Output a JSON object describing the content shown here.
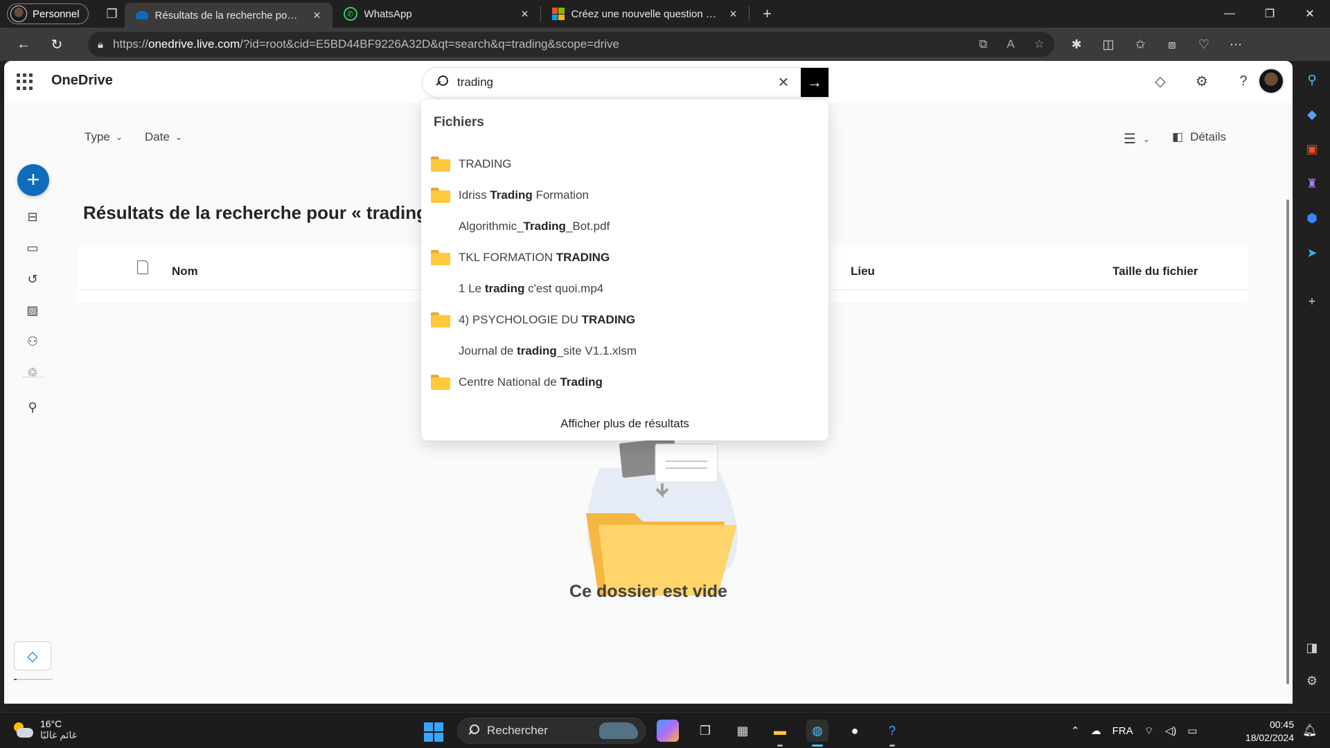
{
  "browser": {
    "profile_label": "Personnel",
    "tabs": [
      {
        "title": "Résultats de la recherche pour « trading »",
        "active": true
      },
      {
        "title": "WhatsApp",
        "active": false
      },
      {
        "title": "Créez une nouvelle question ou commencez une discussion",
        "active": false
      }
    ],
    "url_prefix": "https://",
    "url_host": "onedrive.live.com",
    "url_rest": "/?id=root&cid=E5BD44BF9226A32D&qt=search&q=trading&scope=drive"
  },
  "app": {
    "brand": "OneDrive",
    "search": {
      "value": "trading",
      "placeholder": "Rechercher"
    }
  },
  "dropdown": {
    "heading": "Fichiers",
    "items": [
      {
        "pre": "",
        "bold": "",
        "post": "TRADING",
        "folder": true
      },
      {
        "pre": "Idriss ",
        "bold": "Trading",
        "post": " Formation",
        "folder": true
      },
      {
        "pre": "Algorithmic_",
        "bold": "Trading",
        "post": "_Bot.pdf",
        "folder": false
      },
      {
        "pre": "TKL FORMATION ",
        "bold": "TRADING",
        "post": "",
        "folder": true
      },
      {
        "pre": "1 Le ",
        "bold": "trading",
        "post": " c'est quoi.mp4",
        "folder": false
      },
      {
        "pre": "4) PSYCHOLOGIE DU ",
        "bold": "TRADING",
        "post": "",
        "folder": true
      },
      {
        "pre": "Journal de ",
        "bold": "trading",
        "post": "_site V1.1.xlsm",
        "folder": false
      },
      {
        "pre": "Centre National de ",
        "bold": "Trading",
        "post": "",
        "folder": true
      }
    ],
    "more": "Afficher plus de résultats"
  },
  "filters": {
    "type": "Type",
    "date": "Date"
  },
  "details_label": "Détails",
  "page_title": "Résultats de la recherche pour « trading »",
  "table": {
    "col_name": "Nom",
    "col_location": "Lieu",
    "col_size": "Taille du fichier"
  },
  "empty_state": "Ce dossier est vide",
  "taskbar": {
    "temperature": "16°C",
    "weather_sub": "غائم غالبًا",
    "search_label": "Rechercher",
    "language": "FRA",
    "time": "00:45",
    "date": "18/02/2024"
  },
  "colors": {
    "accent": "#0f6cbd",
    "folder": "#ffc83d"
  }
}
